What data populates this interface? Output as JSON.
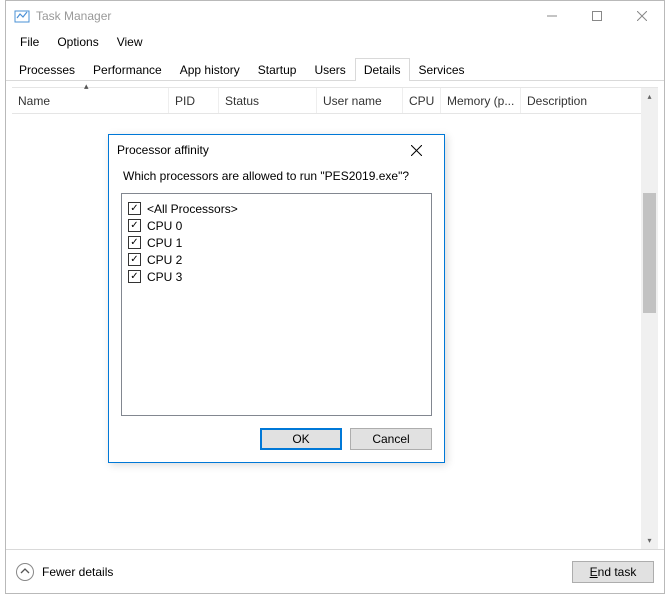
{
  "window": {
    "title": "Task Manager"
  },
  "menubar": {
    "items": [
      "File",
      "Options",
      "View"
    ]
  },
  "tabs": {
    "items": [
      "Processes",
      "Performance",
      "App history",
      "Startup",
      "Users",
      "Details",
      "Services"
    ],
    "active_index": 5
  },
  "columns": {
    "headers": [
      "Name",
      "PID",
      "Status",
      "User name",
      "CPU",
      "Memory (p...",
      "Description"
    ]
  },
  "statusbar": {
    "fewer_details_label": "Fewer details",
    "end_task_label": "End task"
  },
  "dialog": {
    "title": "Processor affinity",
    "prompt": "Which processors are allowed to run \"PES2019.exe\"?",
    "items": [
      {
        "label": "<All Processors>",
        "checked": true
      },
      {
        "label": "CPU 0",
        "checked": true
      },
      {
        "label": "CPU 1",
        "checked": true
      },
      {
        "label": "CPU 2",
        "checked": true
      },
      {
        "label": "CPU 3",
        "checked": true
      }
    ],
    "ok_label": "OK",
    "cancel_label": "Cancel"
  }
}
